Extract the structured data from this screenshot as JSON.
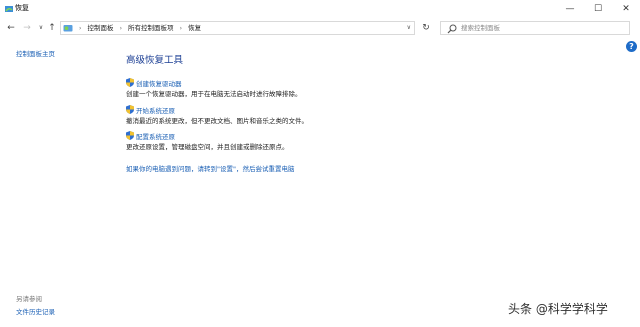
{
  "window": {
    "title": "恢复",
    "minimize": "—",
    "maximize": "☐",
    "close": "✕"
  },
  "nav": {
    "back": "←",
    "forward": "→",
    "recent": "∨",
    "up": "↑",
    "breadcrumbs": [
      "控制面板",
      "所有控制面板项",
      "恢复"
    ],
    "dropdown": "∨",
    "refresh": "↻",
    "search_placeholder": "搜索控制面板"
  },
  "help": "?",
  "sidebar": {
    "home": "控制面板主页",
    "see_also": "另请参阅",
    "file_history": "文件历史记录"
  },
  "main": {
    "heading": "高级恢复工具",
    "items": [
      {
        "link": "创建恢复驱动器",
        "desc": "创建一个恢复驱动器，用于在电脑无法启动时进行故障排除。"
      },
      {
        "link": "开始系统还原",
        "desc": "撤消最近的系统更改，但不更改文档、图片和音乐之类的文件。"
      },
      {
        "link": "配置系统还原",
        "desc": "更改还原设置，管理磁盘空间，并且创建或删除还原点。"
      }
    ],
    "reset_link": "如果你的电脑遇到问题，请转到\"设置\"，然后尝试重置电脑"
  },
  "watermark": "头条 @科学学科学",
  "colors": {
    "link": "#1a5fb4",
    "heading": "#1c3f94",
    "help": "#1e6cc8"
  }
}
